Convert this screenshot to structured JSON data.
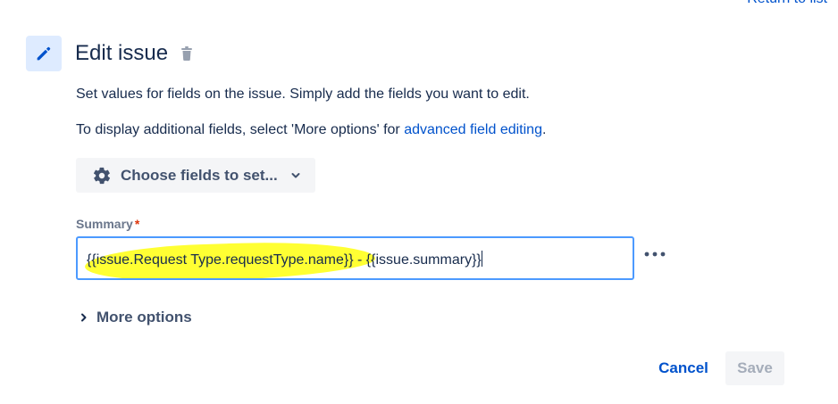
{
  "header": {
    "top_link": "Return to list"
  },
  "action": {
    "title": "Edit issue",
    "description": "Set values for fields on the issue. Simply add the fields you want to edit.",
    "additional_prefix": "To display additional fields, select 'More options' for ",
    "additional_link": "advanced field editing",
    "additional_suffix": "."
  },
  "choose_fields": {
    "label": "Choose fields to set..."
  },
  "summary_field": {
    "label": "Summary",
    "required_marker": "*",
    "value": "{{issue.Request Type.requestType.name}} - {{issue.summary}}"
  },
  "more_options": {
    "label": "More options"
  },
  "footer": {
    "cancel_label": "Cancel",
    "save_label": "Save"
  },
  "colors": {
    "accent": "#0052cc",
    "highlight": "#ffff33",
    "input_border": "#4c9aff",
    "required": "#de350b"
  },
  "icons": {
    "action": "pencil-icon",
    "delete": "trash-icon",
    "fields": "gear-icon",
    "dropdown": "chevron-down-icon",
    "field_menu": "ellipsis-icon",
    "expand": "chevron-right-icon"
  }
}
